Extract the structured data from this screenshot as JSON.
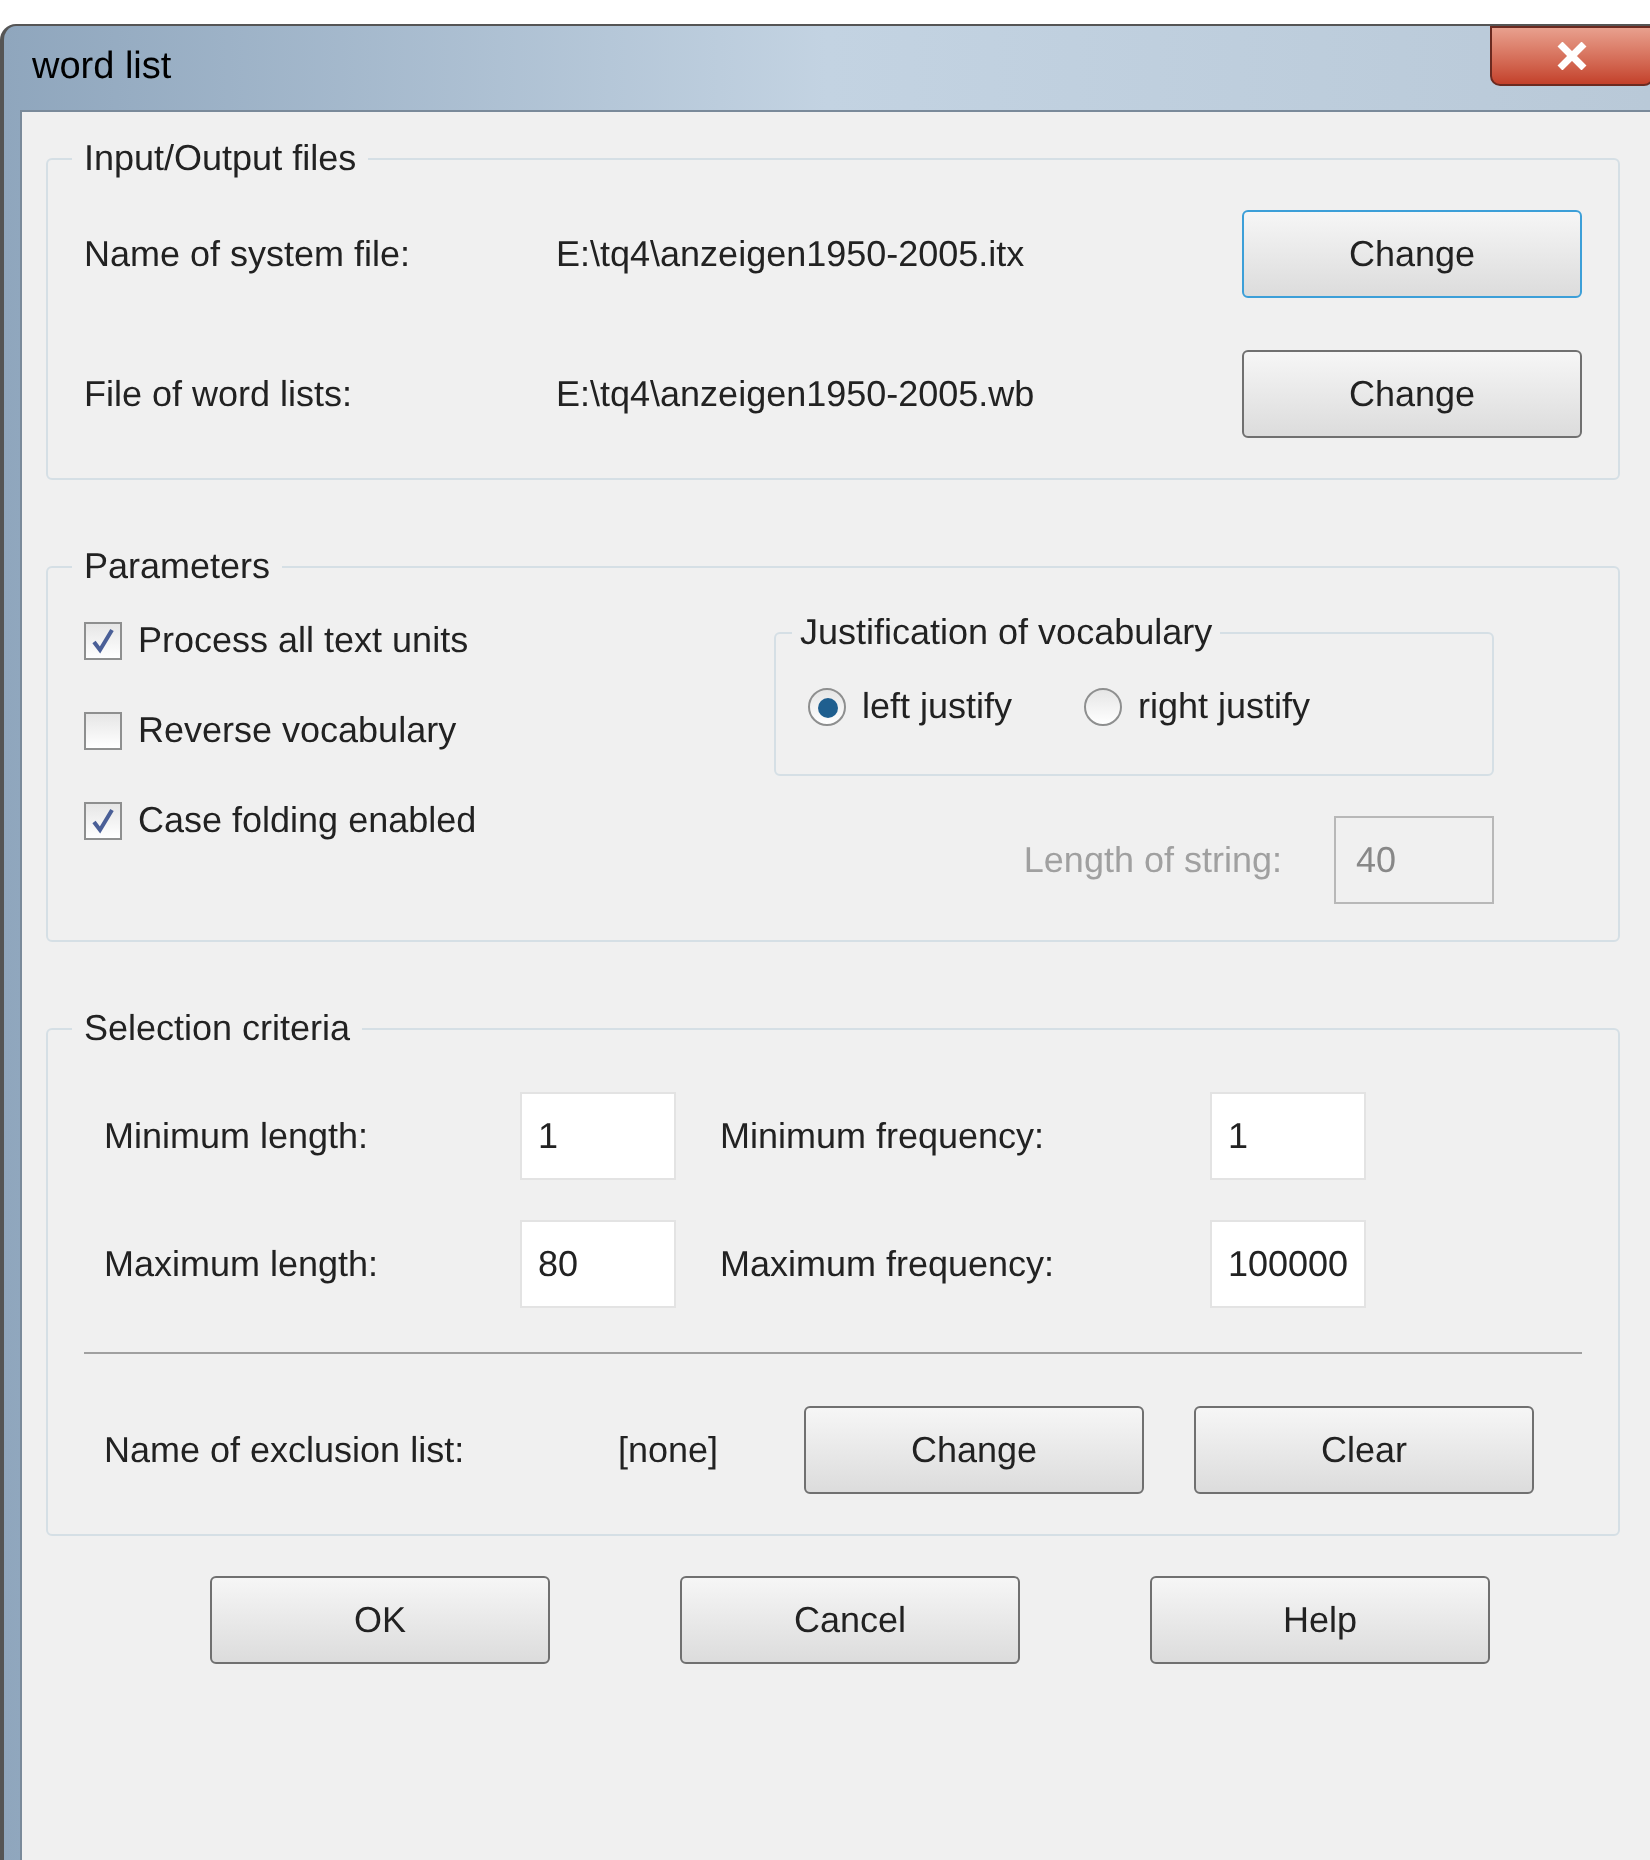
{
  "window": {
    "title": "word list"
  },
  "io_files": {
    "title": "Input/Output files",
    "rows": [
      {
        "label": "Name of system file:",
        "value": "E:\\tq4\\anzeigen1950-2005.itx",
        "button": "Change",
        "focused": true
      },
      {
        "label": "File of word lists:",
        "value": "E:\\tq4\\anzeigen1950-2005.wb",
        "button": "Change",
        "focused": false
      }
    ]
  },
  "parameters": {
    "title": "Parameters",
    "checkboxes": [
      {
        "label": "Process all text units",
        "checked": true
      },
      {
        "label": "Reverse vocabulary",
        "checked": false
      },
      {
        "label": "Case folding enabled",
        "checked": true
      }
    ],
    "justification": {
      "title": "Justification of vocabulary",
      "options": [
        {
          "label": "left justify",
          "selected": true
        },
        {
          "label": "right justify",
          "selected": false
        }
      ]
    },
    "length_of_string": {
      "label": "Length of string:",
      "value": "40",
      "disabled": true
    }
  },
  "selection": {
    "title": "Selection criteria",
    "fields": [
      {
        "label": "Minimum length:",
        "value": "1"
      },
      {
        "label": "Minimum frequency:",
        "value": "1"
      },
      {
        "label": "Maximum length:",
        "value": "80"
      },
      {
        "label": "Maximum frequency:",
        "value": "100000"
      }
    ],
    "exclusion": {
      "label": "Name of exclusion list:",
      "value": "[none]",
      "buttons": [
        "Change",
        "Clear"
      ]
    }
  },
  "buttons": [
    "OK",
    "Cancel",
    "Help"
  ]
}
